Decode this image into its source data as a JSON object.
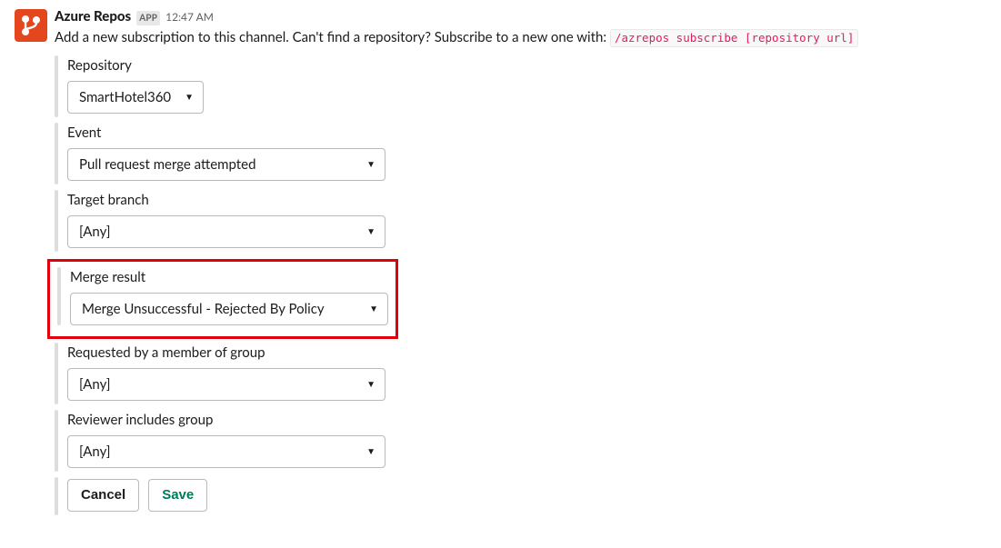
{
  "header": {
    "app_name": "Azure Repos",
    "app_badge": "APP",
    "timestamp": "12:47 AM"
  },
  "message": {
    "text_before_code": "Add a new subscription to this channel. Can't find a repository? Subscribe to a new one with: ",
    "inline_code": "/azrepos subscribe [repository url]"
  },
  "fields": {
    "repository": {
      "label": "Repository",
      "value": "SmartHotel360"
    },
    "event": {
      "label": "Event",
      "value": "Pull request merge attempted"
    },
    "target_branch": {
      "label": "Target branch",
      "value": "[Any]"
    },
    "merge_result": {
      "label": "Merge result",
      "value": "Merge Unsuccessful - Rejected By Policy"
    },
    "requested_by": {
      "label": "Requested by a member of group",
      "value": "[Any]"
    },
    "reviewer_includes": {
      "label": "Reviewer includes group",
      "value": "[Any]"
    }
  },
  "actions": {
    "cancel": "Cancel",
    "save": "Save"
  }
}
